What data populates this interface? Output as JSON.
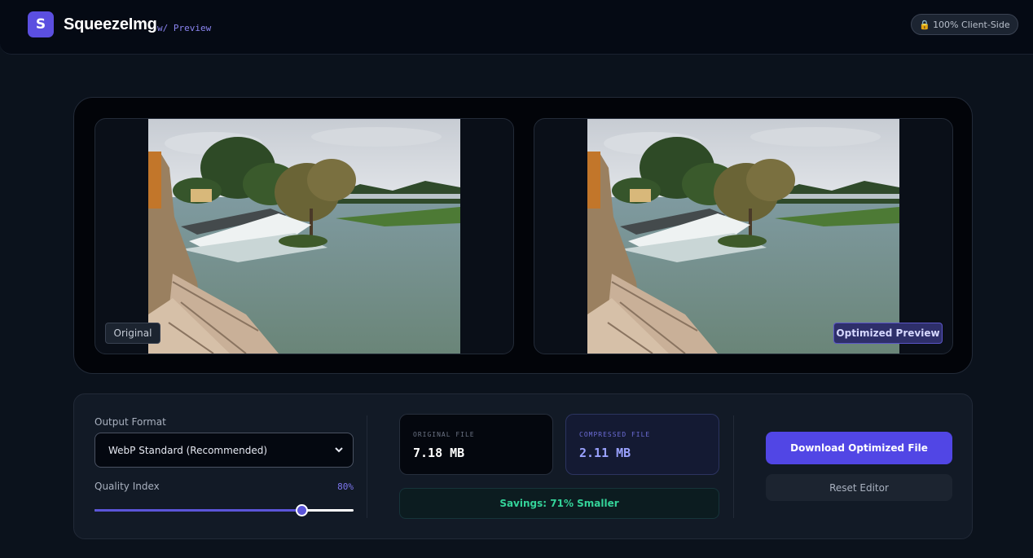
{
  "header": {
    "logo_letter": "S",
    "app_name": "SqueezeImg",
    "app_sub": "w/ Preview",
    "client_badge": "100% Client-Side",
    "lock_icon": "lock-icon"
  },
  "preview": {
    "original_label": "Original",
    "optimized_label": "Optimized Preview"
  },
  "controls": {
    "format_label": "Output Format",
    "format_selected": "WebP Standard (Recommended)",
    "quality_label": "Quality Index",
    "quality_value": "80%",
    "quality_percent": 80
  },
  "stats": {
    "original_title": "ORIGINAL FILE",
    "original_value": "7.18 MB",
    "compressed_title": "COMPRESSED FILE",
    "compressed_value": "2.11 MB",
    "savings": "Savings: 71% Smaller"
  },
  "actions": {
    "download": "Download Optimized File",
    "reset": "Reset Editor"
  },
  "colors": {
    "accent": "#5146e5",
    "savings": "#34d399",
    "background": "#0b121c"
  }
}
